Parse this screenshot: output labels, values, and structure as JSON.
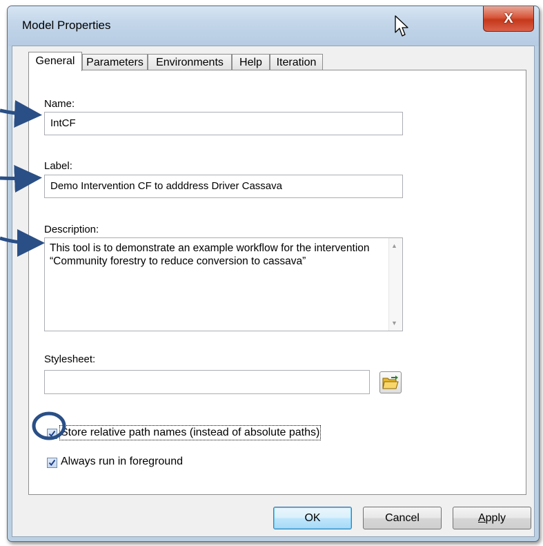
{
  "window": {
    "title": "Model Properties",
    "close_glyph": "X"
  },
  "tabs": [
    {
      "label": "General",
      "active": true
    },
    {
      "label": "Parameters",
      "active": false
    },
    {
      "label": "Environments",
      "active": false
    },
    {
      "label": "Help",
      "active": false
    },
    {
      "label": "Iteration",
      "active": false
    }
  ],
  "general": {
    "name_label": "Name:",
    "name_value": "IntCF",
    "label_label": "Label:",
    "label_value": "Demo Intervention CF to adddress Driver Cassava",
    "description_label": "Description:",
    "description_value": "This tool is to demonstrate an example workflow for the intervention “Community forestry to reduce conversion to cassava”",
    "stylesheet_label": "Stylesheet:",
    "stylesheet_value": "",
    "store_relative_label": "Store relative path names (instead of absolute paths)",
    "store_relative_checked": true,
    "always_foreground_label": "Always run in foreground",
    "always_foreground_checked": true
  },
  "buttons": {
    "ok": "OK",
    "cancel": "Cancel",
    "apply": "Apply"
  },
  "icons": {
    "close": "close-icon",
    "browse": "open-folder-icon",
    "cursor": "mouse-pointer-icon",
    "scroll_up": "scroll-up-arrow-icon",
    "scroll_down": "scroll-down-arrow-icon"
  },
  "colors": {
    "annotation": "#2a4f86",
    "title_bar": "#c3d6ea",
    "close_button": "#c5381b",
    "default_button_border": "#3c7fb1"
  }
}
